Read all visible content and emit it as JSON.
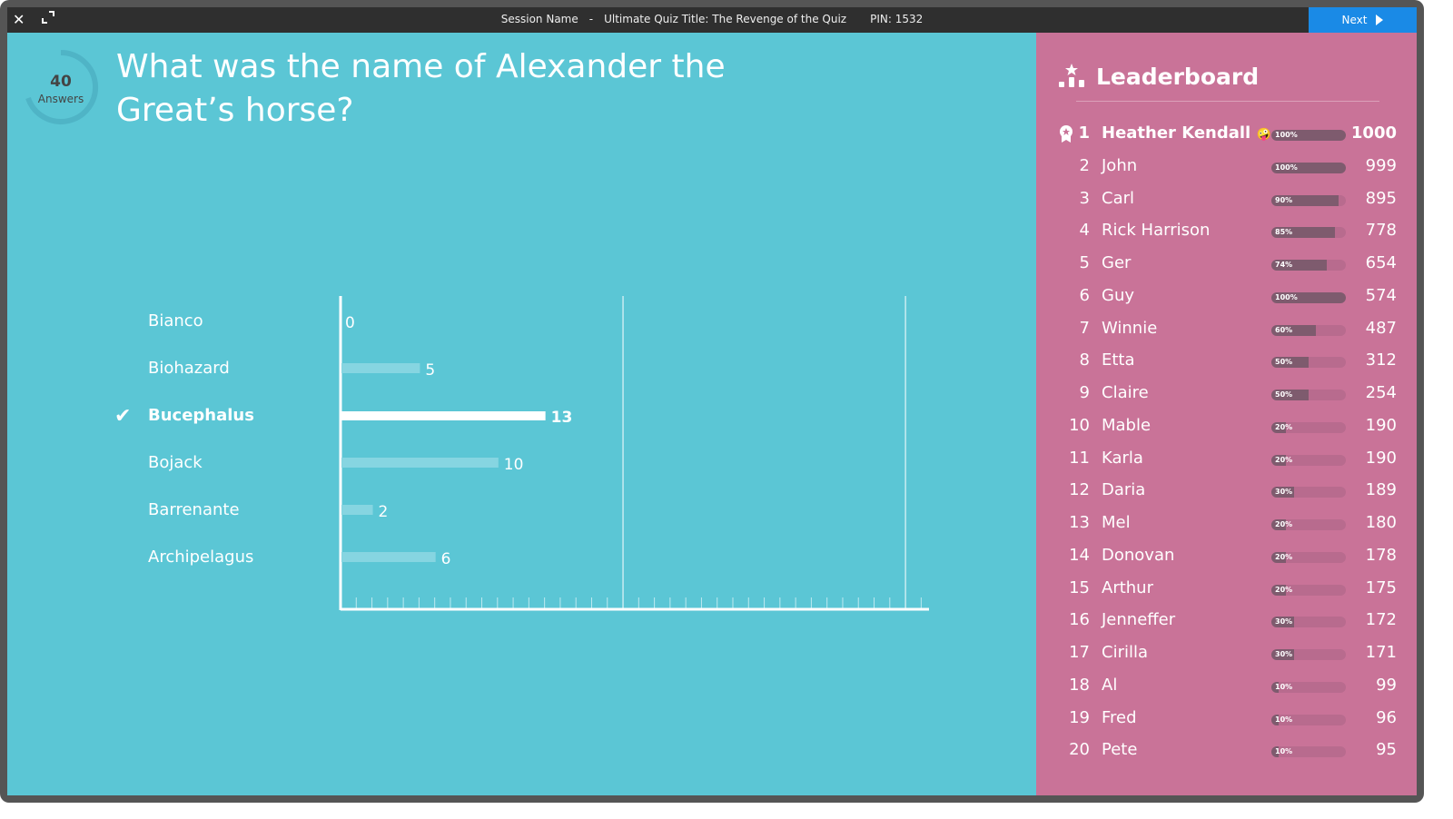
{
  "titlebar": {
    "session": "Session Name",
    "separator": "-",
    "quiz_title": "Ultimate Quiz Title: The Revenge of the Quiz",
    "pin": "PIN: 1532",
    "next_label": "Next",
    "icons": [
      "close-icon",
      "expand-icon",
      "play-icon"
    ]
  },
  "answers": {
    "count": "40",
    "label": "Answers"
  },
  "question": "What was the name of Alexander the Great’s horse?",
  "colors": {
    "main_bg": "#5bc6d5",
    "leaderboard_bg": "#c97398",
    "next_button": "#1a8ae6",
    "titlebar": "#2f2f2f",
    "bar_fill": "#7e5b6e"
  },
  "chart_data": {
    "type": "bar",
    "orientation": "horizontal",
    "categories": [
      "Bianco",
      "Biohazard",
      "Bucephalus",
      "Bojack",
      "Barrenante",
      "Archipelagus"
    ],
    "values": [
      0,
      5,
      13,
      10,
      2,
      6
    ],
    "correct": "Bucephalus",
    "xlim": [
      0,
      37.5
    ],
    "gridlines": [
      18,
      36
    ],
    "tick_interval": 1
  },
  "leaderboard": {
    "title": "Leaderboard",
    "rows": [
      {
        "rank": "1",
        "name": "Heather Kendall",
        "emoji": "🤪",
        "pct": 100,
        "pct_label": "100%",
        "score": "1000"
      },
      {
        "rank": "2",
        "name": "John",
        "pct": 100,
        "pct_label": "100%",
        "score": "999"
      },
      {
        "rank": "3",
        "name": "Carl",
        "pct": 90,
        "pct_label": "90%",
        "score": "895"
      },
      {
        "rank": "4",
        "name": "Rick Harrison",
        "pct": 85,
        "pct_label": "85%",
        "score": "778"
      },
      {
        "rank": "5",
        "name": "Ger",
        "pct": 74,
        "pct_label": "74%",
        "score": "654"
      },
      {
        "rank": "6",
        "name": "Guy",
        "pct": 100,
        "pct_label": "100%",
        "score": "574"
      },
      {
        "rank": "7",
        "name": "Winnie",
        "pct": 60,
        "pct_label": "60%",
        "score": "487"
      },
      {
        "rank": "8",
        "name": "Etta",
        "pct": 50,
        "pct_label": "50%",
        "score": "312"
      },
      {
        "rank": "9",
        "name": "Claire",
        "pct": 50,
        "pct_label": "50%",
        "score": "254"
      },
      {
        "rank": "10",
        "name": "Mable",
        "pct": 20,
        "pct_label": "20%",
        "score": "190"
      },
      {
        "rank": "11",
        "name": "Karla",
        "pct": 20,
        "pct_label": "20%",
        "score": "190"
      },
      {
        "rank": "12",
        "name": "Daria",
        "pct": 30,
        "pct_label": "30%",
        "score": "189"
      },
      {
        "rank": "13",
        "name": "Mel",
        "pct": 20,
        "pct_label": "20%",
        "score": "180"
      },
      {
        "rank": "14",
        "name": "Donovan",
        "pct": 20,
        "pct_label": "20%",
        "score": "178"
      },
      {
        "rank": "15",
        "name": "Arthur",
        "pct": 20,
        "pct_label": "20%",
        "score": "175"
      },
      {
        "rank": "16",
        "name": "Jenneffer",
        "pct": 30,
        "pct_label": "30%",
        "score": "172"
      },
      {
        "rank": "17",
        "name": "Cirilla",
        "pct": 30,
        "pct_label": "30%",
        "score": "171"
      },
      {
        "rank": "18",
        "name": "Al",
        "pct": 10,
        "pct_label": "10%",
        "score": "99"
      },
      {
        "rank": "19",
        "name": "Fred",
        "pct": 10,
        "pct_label": "10%",
        "score": "96"
      },
      {
        "rank": "20",
        "name": "Pete",
        "pct": 10,
        "pct_label": "10%",
        "score": "95"
      }
    ]
  }
}
